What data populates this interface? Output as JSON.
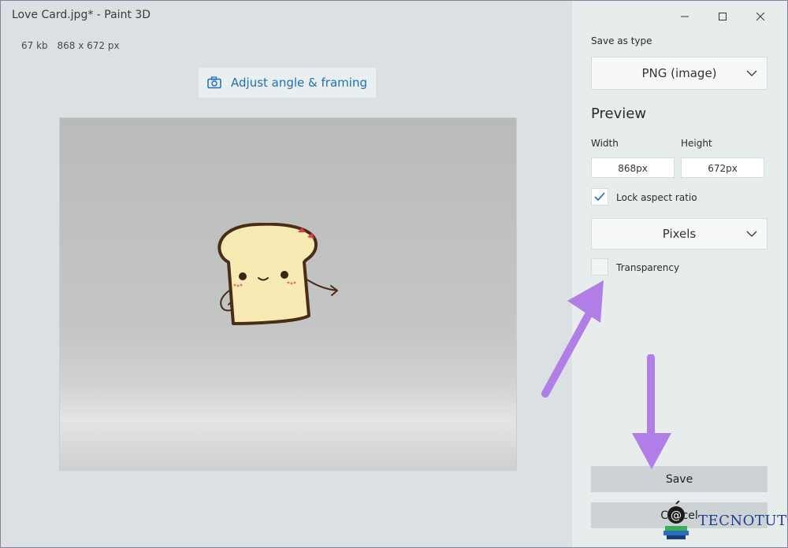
{
  "window": {
    "title": "Love Card.jpg* - Paint 3D"
  },
  "file_info": {
    "size": "67 kb",
    "dimensions": "868 x 672 px"
  },
  "toolbar": {
    "adjust_label": "Adjust angle & framing"
  },
  "panel": {
    "save_as_type_label": "Save as type",
    "file_type": "PNG (image)",
    "preview_heading": "Preview",
    "width_label": "Width",
    "height_label": "Height",
    "width_value": "868px",
    "height_value": "672px",
    "lock_aspect_label": "Lock aspect ratio",
    "lock_aspect_checked": true,
    "units": "Pixels",
    "transparency_label": "Transparency",
    "transparency_checked": false,
    "save_label": "Save",
    "cancel_label": "Cancel"
  },
  "watermark": {
    "text": "TECNOTUTO"
  },
  "colors": {
    "accent": "#1e6fb8",
    "arrow": "#b07ee6",
    "toast_fill": "#f8eab3",
    "toast_outline": "#4a2c17",
    "cheek": "#e8647a"
  },
  "icons": {
    "adjust": "camera-icon",
    "dropdown": "chevron-down-icon",
    "check": "checkmark-icon",
    "minimize": "minimize-icon",
    "maximize": "maximize-icon",
    "close": "close-icon"
  }
}
